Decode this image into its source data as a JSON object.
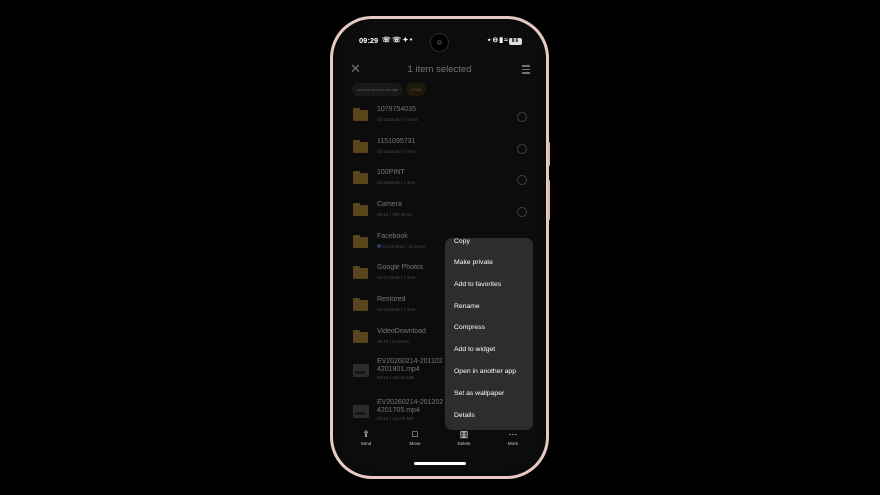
{
  "status_bar": {
    "time": "09:29",
    "left_icons": [
      "whatsapp-icon",
      "whatsapp-icon",
      "sparkle-icon",
      "dot-icon"
    ],
    "right_icons": [
      "bluetooth-icon",
      "do-not-disturb-icon",
      "signal-icon",
      "wifi-icon",
      "battery-icon"
    ],
    "battery_level": "86"
  },
  "header": {
    "title": "1 item selected",
    "close_icon": "close-icon",
    "select_all_icon": "select-all-icon"
  },
  "breadcrumb": {
    "items": [
      "Internal shared storage",
      "DCIM"
    ],
    "active_color": "#d8a23a"
  },
  "files": [
    {
      "name": "1079754035",
      "date": "02/13/2026",
      "info": "2 items",
      "type": "folder"
    },
    {
      "name": "1151095731",
      "date": "02/16/2026",
      "info": "1 item",
      "type": "folder"
    },
    {
      "name": "100PINT",
      "date": "02/16/2026",
      "info": "1 item",
      "type": "folder"
    },
    {
      "name": "Camera",
      "date": "08:10",
      "info": "490 items",
      "type": "folder"
    },
    {
      "name": "Facebook",
      "date": "02/18/2026",
      "info": "11 items",
      "type": "folder",
      "badge": "facebook-icon"
    },
    {
      "name": "Google Photos",
      "date": "02/17/2026",
      "info": "1 item",
      "type": "folder"
    },
    {
      "name": "Restored",
      "date": "02/15/2026",
      "info": "1 item",
      "type": "folder"
    },
    {
      "name": "VideoDownload",
      "date": "08:10",
      "info": "44 items",
      "type": "folder"
    },
    {
      "name": "EV20260214-201102\n4201801.mp4",
      "date": "02/14",
      "info": "109.60 MB",
      "type": "video"
    },
    {
      "name": "EV20260214-201202\n4201705.mp4",
      "date": "02/14",
      "info": "110.00 MB",
      "type": "video"
    }
  ],
  "bottom_bar": [
    {
      "label": "Send",
      "icon": "share-icon"
    },
    {
      "label": "Move",
      "icon": "folder-move-icon"
    },
    {
      "label": "Delete",
      "icon": "trash-icon"
    },
    {
      "label": "More",
      "icon": "more-icon"
    }
  ],
  "context_menu": [
    "Copy",
    "Make private",
    "Add to favorites",
    "Rename",
    "Compress",
    "Add to widget",
    "Open in another app",
    "Set as wallpaper",
    "Details"
  ],
  "colors": {
    "phone_frame": "#e8c9c3",
    "folder": "#c49733",
    "menu_bg": "#2d2d2d"
  }
}
